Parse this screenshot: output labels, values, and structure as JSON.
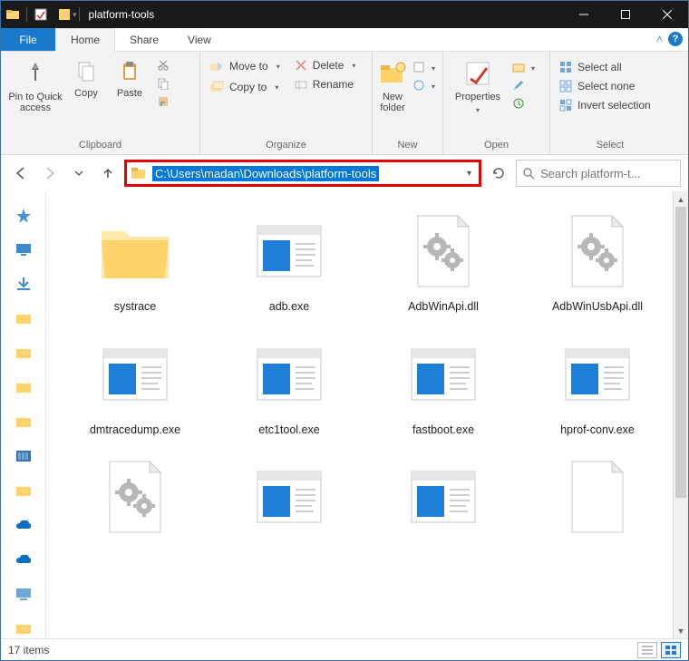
{
  "window": {
    "title": "platform-tools"
  },
  "ribbon": {
    "file": "File",
    "tabs": [
      "Home",
      "Share",
      "View"
    ],
    "active_tab": "Home",
    "clipboard": {
      "pin": "Pin to Quick access",
      "copy": "Copy",
      "paste": "Paste",
      "label": "Clipboard"
    },
    "organize": {
      "moveto": "Move to",
      "copyto": "Copy to",
      "delete": "Delete",
      "rename": "Rename",
      "label": "Organize"
    },
    "new": {
      "newfolder": "New folder",
      "label": "New"
    },
    "open": {
      "properties": "Properties",
      "label": "Open"
    },
    "select": {
      "all": "Select all",
      "none": "Select none",
      "invert": "Invert selection",
      "label": "Select"
    }
  },
  "nav": {
    "path": "C:\\Users\\madan\\Downloads\\platform-tools",
    "search_placeholder": "Search platform-t..."
  },
  "items": [
    {
      "name": "systrace",
      "type": "folder"
    },
    {
      "name": "adb.exe",
      "type": "exe"
    },
    {
      "name": "AdbWinApi.dll",
      "type": "dll"
    },
    {
      "name": "AdbWinUsbApi.dll",
      "type": "dll"
    },
    {
      "name": "dmtracedump.exe",
      "type": "exe"
    },
    {
      "name": "etc1tool.exe",
      "type": "exe"
    },
    {
      "name": "fastboot.exe",
      "type": "exe"
    },
    {
      "name": "hprof-conv.exe",
      "type": "exe"
    },
    {
      "name": "",
      "type": "dll"
    },
    {
      "name": "",
      "type": "exe"
    },
    {
      "name": "",
      "type": "exe"
    },
    {
      "name": "",
      "type": "blank"
    }
  ],
  "status": {
    "count": "17 items"
  }
}
